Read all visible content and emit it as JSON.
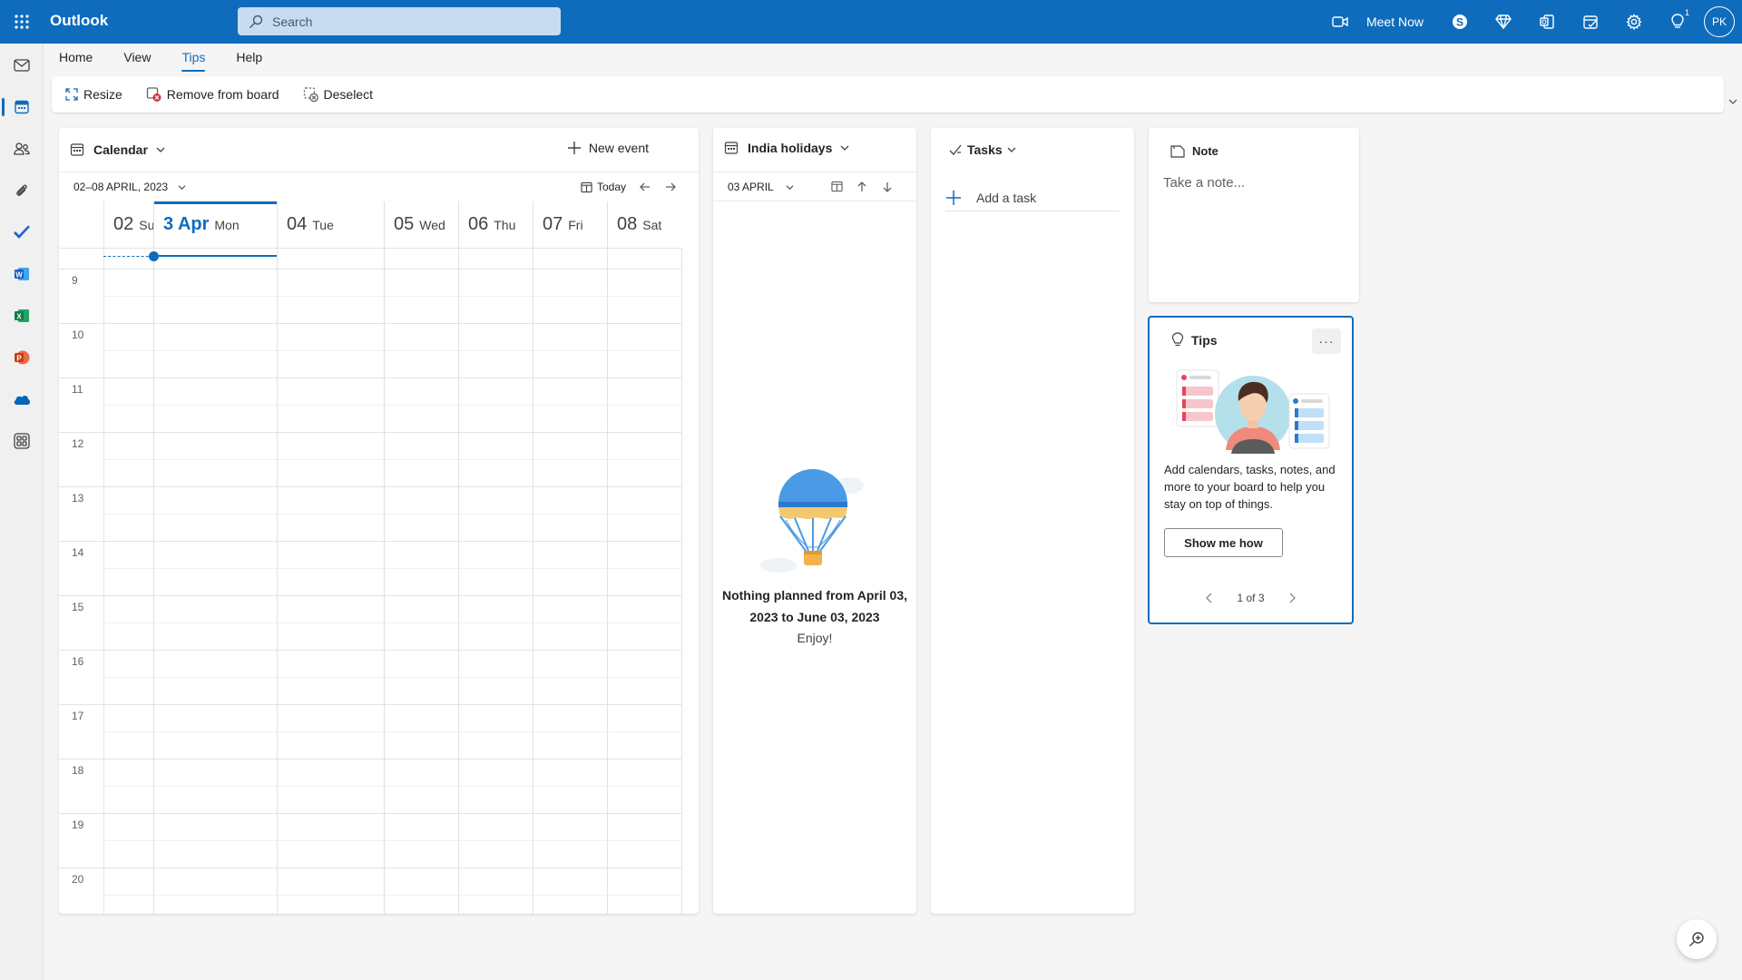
{
  "app": {
    "title": "Outlook"
  },
  "search": {
    "placeholder": "Search"
  },
  "topbar": {
    "meet_now": "Meet Now",
    "notification_count": "1",
    "avatar_initials": "PK"
  },
  "tabs": [
    {
      "label": "Home"
    },
    {
      "label": "View"
    },
    {
      "label": "Tips"
    },
    {
      "label": "Help"
    }
  ],
  "ribbon": {
    "resize": "Resize",
    "remove": "Remove from board",
    "deselect": "Deselect"
  },
  "calendar": {
    "title": "Calendar",
    "new_event": "New event",
    "range": "02–08 APRIL, 2023",
    "today": "Today",
    "days": [
      {
        "num": "02",
        "name": "Sun"
      },
      {
        "num": "3 Apr",
        "name": "Mon"
      },
      {
        "num": "04",
        "name": "Tue"
      },
      {
        "num": "05",
        "name": "Wed"
      },
      {
        "num": "06",
        "name": "Thu"
      },
      {
        "num": "07",
        "name": "Fri"
      },
      {
        "num": "08",
        "name": "Sat"
      }
    ],
    "hours": [
      "9",
      "10",
      "11",
      "12",
      "13",
      "14",
      "15",
      "16",
      "17",
      "18",
      "19",
      "20"
    ]
  },
  "holidays": {
    "title": "India holidays",
    "date": "03 APRIL",
    "empty_message": "Nothing planned from April 03, 2023 to June 03, 2023",
    "empty_sub": "Enjoy!"
  },
  "tasks": {
    "title": "Tasks",
    "add_task": "Add a task"
  },
  "note": {
    "title": "Note",
    "placeholder": "Take a note..."
  },
  "tips": {
    "title": "Tips",
    "more": "···",
    "text": "Add calendars, tasks, notes, and more to your board to help you stay on top of things.",
    "button": "Show me how",
    "pager": "1 of 3"
  },
  "colors": {
    "brand": "#0f6cbd",
    "search_bg": "#c7dcf0"
  }
}
